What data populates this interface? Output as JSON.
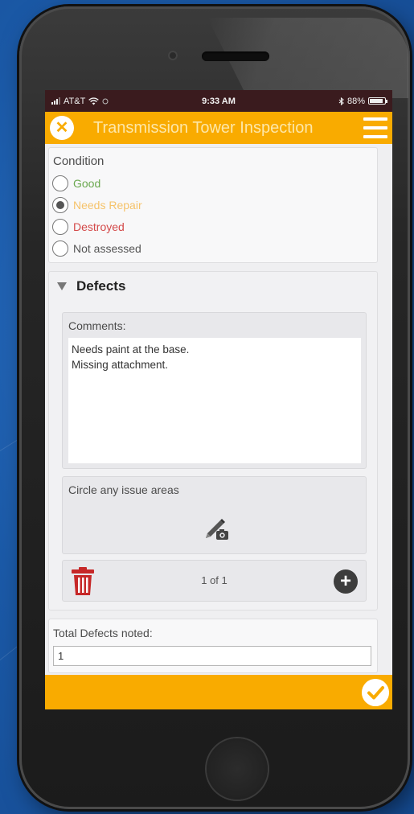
{
  "status_bar": {
    "carrier": "AT&T",
    "time": "9:33 AM",
    "battery": "88%",
    "battery_level": 0.88
  },
  "header": {
    "title": "Transmission Tower Inspection",
    "close_icon": "close-icon",
    "menu_icon": "hamburger-menu-icon"
  },
  "condition": {
    "label": "Condition",
    "selected": "Needs Repair",
    "options": [
      {
        "label": "Good",
        "color": "#6aa84f",
        "checked": false
      },
      {
        "label": "Needs Repair",
        "color": "#f6c36a",
        "checked": true
      },
      {
        "label": "Destroyed",
        "color": "#d44a4a",
        "checked": false
      },
      {
        "label": "Not assessed",
        "color": "#555555",
        "checked": false
      }
    ]
  },
  "defects": {
    "title": "Defects",
    "comments_label": "Comments:",
    "comments_value": "Needs paint at the base.\nMissing attachment.",
    "sketch_label": "Circle any issue areas",
    "sketch_icon": "pen-camera-icon",
    "pager": "1 of 1",
    "delete_icon": "trash-icon",
    "add_icon": "plus-circle-icon"
  },
  "total": {
    "label": "Total Defects noted:",
    "value": "1"
  },
  "footer": {
    "submit_icon": "check-circle-icon"
  },
  "colors": {
    "accent": "#f9ab00",
    "status_bar": "#3a1b1e",
    "delete": "#c62828"
  }
}
